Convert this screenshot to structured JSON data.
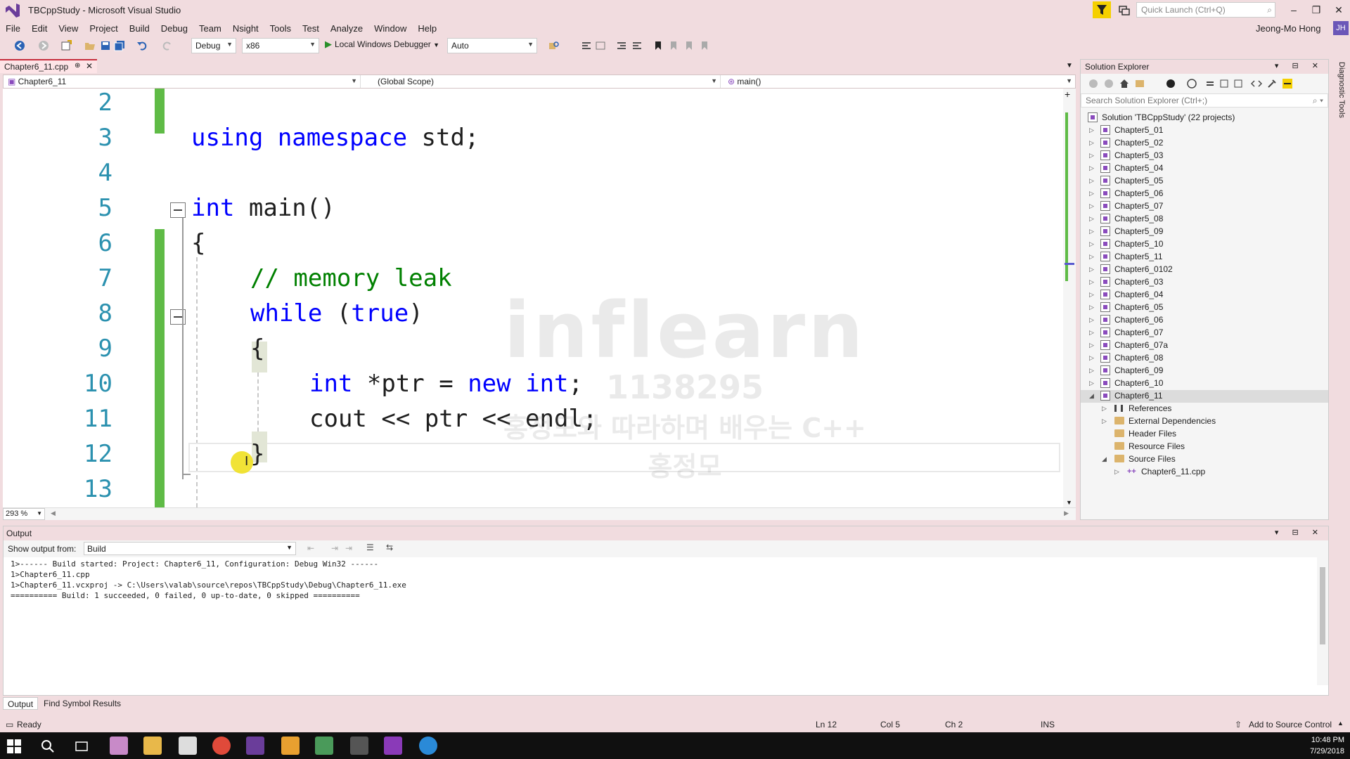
{
  "window": {
    "title": "TBCppStudy - Microsoft Visual Studio",
    "quick_launch_placeholder": "Quick Launch (Ctrl+Q)",
    "user_name": "Jeong-Mo Hong",
    "user_initials": "JH",
    "minimize_glyph": "–",
    "restore_glyph": "❐",
    "close_glyph": "✕"
  },
  "menu": [
    "File",
    "Edit",
    "View",
    "Project",
    "Build",
    "Debug",
    "Team",
    "Nsight",
    "Tools",
    "Test",
    "Analyze",
    "Window",
    "Help"
  ],
  "toolbar": {
    "configuration": "Debug",
    "platform": "x86",
    "debugger_label": "Local Windows Debugger",
    "debugger_mode": "Auto"
  },
  "editor": {
    "tab_label": "Chapter6_11.cpp",
    "tab_pin_glyph": "⊕",
    "tab_close_glyph": "✕",
    "nav_project": "Chapter6_11",
    "nav_scope": "(Global Scope)",
    "nav_member": "main()",
    "zoom": "293 %",
    "line_numbers": [
      "2",
      "3",
      "4",
      "5",
      "6",
      "7",
      "8",
      "9",
      "10",
      "11",
      "12",
      "13"
    ],
    "code": {
      "l3_kw": "using namespace",
      "l3_rest": " std;",
      "l5_kw": "int",
      "l5_rest": " main()",
      "l6": "{",
      "l7_comment": "// memory leak",
      "l8_kw1": "while",
      "l8_mid": " (",
      "l8_kw2": "true",
      "l8_end": ")",
      "l9": "{",
      "l10_kw1": "int",
      "l10_mid": " *ptr = ",
      "l10_kw2": "new",
      "l10_sp": " ",
      "l10_kw3": "int",
      "l10_end": ";",
      "l11": "cout << ptr << endl;",
      "l12": "}"
    },
    "watermark": {
      "logo": "inflearn",
      "id": "1138295",
      "course": "홍정모와 따라하며 배우는 C++",
      "name": "홍정모"
    }
  },
  "solution_explorer": {
    "title": "Solution Explorer",
    "search_placeholder": "Search Solution Explorer (Ctrl+;)",
    "solution_label": "Solution 'TBCppStudy' (22 projects)",
    "projects": [
      "Chapter5_01",
      "Chapter5_02",
      "Chapter5_03",
      "Chapter5_04",
      "Chapter5_05",
      "Chapter5_06",
      "Chapter5_07",
      "Chapter5_08",
      "Chapter5_09",
      "Chapter5_10",
      "Chapter5_11",
      "Chapter6_0102",
      "Chapter6_03",
      "Chapter6_04",
      "Chapter6_05",
      "Chapter6_06",
      "Chapter6_07",
      "Chapter6_07a",
      "Chapter6_08",
      "Chapter6_09",
      "Chapter6_10",
      "Chapter6_11"
    ],
    "expanded_children": [
      "References",
      "External Dependencies",
      "Header Files",
      "Resource Files",
      "Source Files"
    ],
    "source_file": "Chapter6_11.cpp",
    "diagnostic_tab": "Diagnostic Tools"
  },
  "output": {
    "title": "Output",
    "show_from_label": "Show output from:",
    "source": "Build",
    "lines": [
      "1>------ Build started: Project: Chapter6_11, Configuration: Debug Win32 ------",
      "1>Chapter6_11.cpp",
      "1>Chapter6_11.vcxproj -> C:\\Users\\valab\\source\\repos\\TBCppStudy\\Debug\\Chapter6_11.exe",
      "========== Build: 1 succeeded, 0 failed, 0 up-to-date, 0 skipped =========="
    ],
    "tabs": [
      "Output",
      "Find Symbol Results"
    ]
  },
  "status": {
    "state": "Ready",
    "line": "Ln 12",
    "col": "Col 5",
    "ch": "Ch 2",
    "mode": "INS",
    "source_control": "Add to Source Control"
  },
  "taskbar": {
    "time": "10:48 PM",
    "date": "7/29/2018"
  },
  "colors": {
    "accent": "#c7303e",
    "keyword": "#0000ff",
    "comment": "#008000",
    "line_number": "#2b91af",
    "change_bar": "#5fbb46"
  }
}
